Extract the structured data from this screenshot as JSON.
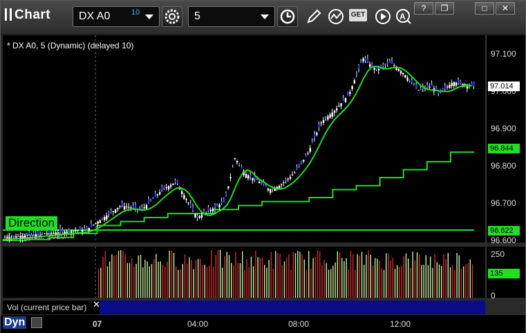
{
  "window": {
    "title": "Chart"
  },
  "toolbar": {
    "symbol": "DX A0",
    "symbol_sup": "10",
    "interval": "5",
    "icons": [
      "settings-gear-icon",
      "clock-icon",
      "pencil-icon",
      "study-icon",
      "get-icon",
      "play-icon",
      "search-a-icon"
    ],
    "get_label": "GET"
  },
  "chart": {
    "header": "* DX A0, 5 (Dynamic) (delayed 10)",
    "direction_label": "Direction",
    "copyright": "© eSignal, 2020",
    "price_axis": [
      "97.100",
      "97.000",
      "96.900",
      "96.800",
      "96.700",
      "96.600"
    ],
    "last_price": "97.014",
    "upper_line_value": "96.844",
    "lower_line_value": "96.622"
  },
  "volume": {
    "axis": [
      "250",
      "0"
    ],
    "current": "135",
    "study_label": "Vol (current price bar)"
  },
  "time_axis": {
    "labels": [
      "07",
      "04:00",
      "08:00",
      "12:00"
    ],
    "dyn_label": "Dyn"
  },
  "chart_data": {
    "type": "line",
    "yrange": [
      96.6,
      97.12
    ],
    "upper_line": [
      96.622,
      96.625,
      96.63,
      96.64,
      96.66,
      96.67,
      96.68,
      96.69,
      96.69,
      96.7,
      96.71,
      96.72,
      96.72,
      96.73,
      96.75,
      96.76,
      96.78,
      96.8,
      96.82,
      96.844,
      96.844
    ],
    "lower_line": [
      96.622,
      96.622
    ]
  }
}
